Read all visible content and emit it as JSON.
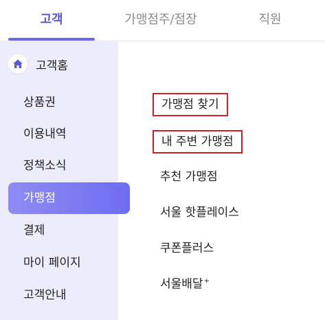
{
  "tabs": [
    {
      "label": "고객"
    },
    {
      "label": "가맹점주/점장"
    },
    {
      "label": "직원"
    }
  ],
  "sidebar": {
    "home_label": "고객홈",
    "items": [
      {
        "label": "상품권"
      },
      {
        "label": "이용내역"
      },
      {
        "label": "정책소식"
      },
      {
        "label": "가맹점"
      },
      {
        "label": "결제"
      },
      {
        "label": "마이 페이지"
      },
      {
        "label": "고객안내"
      }
    ],
    "active_item": "가맹점"
  },
  "submenu": {
    "items": [
      {
        "label": "가맹점 찾기",
        "highlighted": true
      },
      {
        "label": "내 주변 가맹점",
        "highlighted": true
      },
      {
        "label": "추천 가맹점",
        "highlighted": false
      },
      {
        "label": "서울 핫플레이스",
        "highlighted": false
      },
      {
        "label": "쿠폰플러스",
        "highlighted": false
      },
      {
        "label": "서울배달",
        "superscript": "+",
        "highlighted": false
      }
    ]
  },
  "colors": {
    "accent": "#5a59d6",
    "sidebar_bg": "#ececfb",
    "highlight_border": "#d21f26"
  }
}
